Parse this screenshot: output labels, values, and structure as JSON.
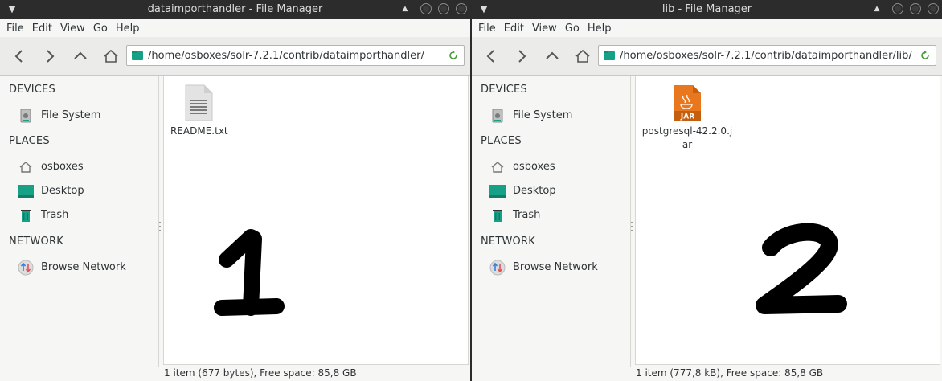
{
  "windows": [
    {
      "title": "dataimporthandler - File Manager",
      "menu": [
        "File",
        "Edit",
        "View",
        "Go",
        "Help"
      ],
      "address": "/home/osboxes/solr-7.2.1/contrib/dataimporthandler/",
      "sidebar": {
        "devices_heading": "DEVICES",
        "places_heading": "PLACES",
        "network_heading": "NETWORK",
        "file_system": "File System",
        "home": "osboxes",
        "desktop": "Desktop",
        "trash": "Trash",
        "browse_network": "Browse Network"
      },
      "files": [
        {
          "name": "README.txt",
          "icon": "text-file-icon"
        }
      ],
      "status": "1 item (677 bytes), Free space: 85,8 GB",
      "annotation": "1"
    },
    {
      "title": "lib - File Manager",
      "menu": [
        "File",
        "Edit",
        "View",
        "Go",
        "Help"
      ],
      "address": "/home/osboxes/solr-7.2.1/contrib/dataimporthandler/lib/",
      "sidebar": {
        "devices_heading": "DEVICES",
        "places_heading": "PLACES",
        "network_heading": "NETWORK",
        "file_system": "File System",
        "home": "osboxes",
        "desktop": "Desktop",
        "trash": "Trash",
        "browse_network": "Browse Network"
      },
      "files": [
        {
          "name_line1": "postgresql-42.2.0.j",
          "name_line2": "ar",
          "icon_label": "JAR",
          "icon": "jar-file-icon"
        }
      ],
      "status": "1 item (777,8 kB), Free space: 85,8 GB",
      "annotation": "2"
    }
  ],
  "colors": {
    "titlebar": "#2c2c2c",
    "accent_green": "#16a085",
    "jar_orange": "#e8771e",
    "network_red": "#e0535b",
    "network_blue": "#3b7dd8"
  }
}
